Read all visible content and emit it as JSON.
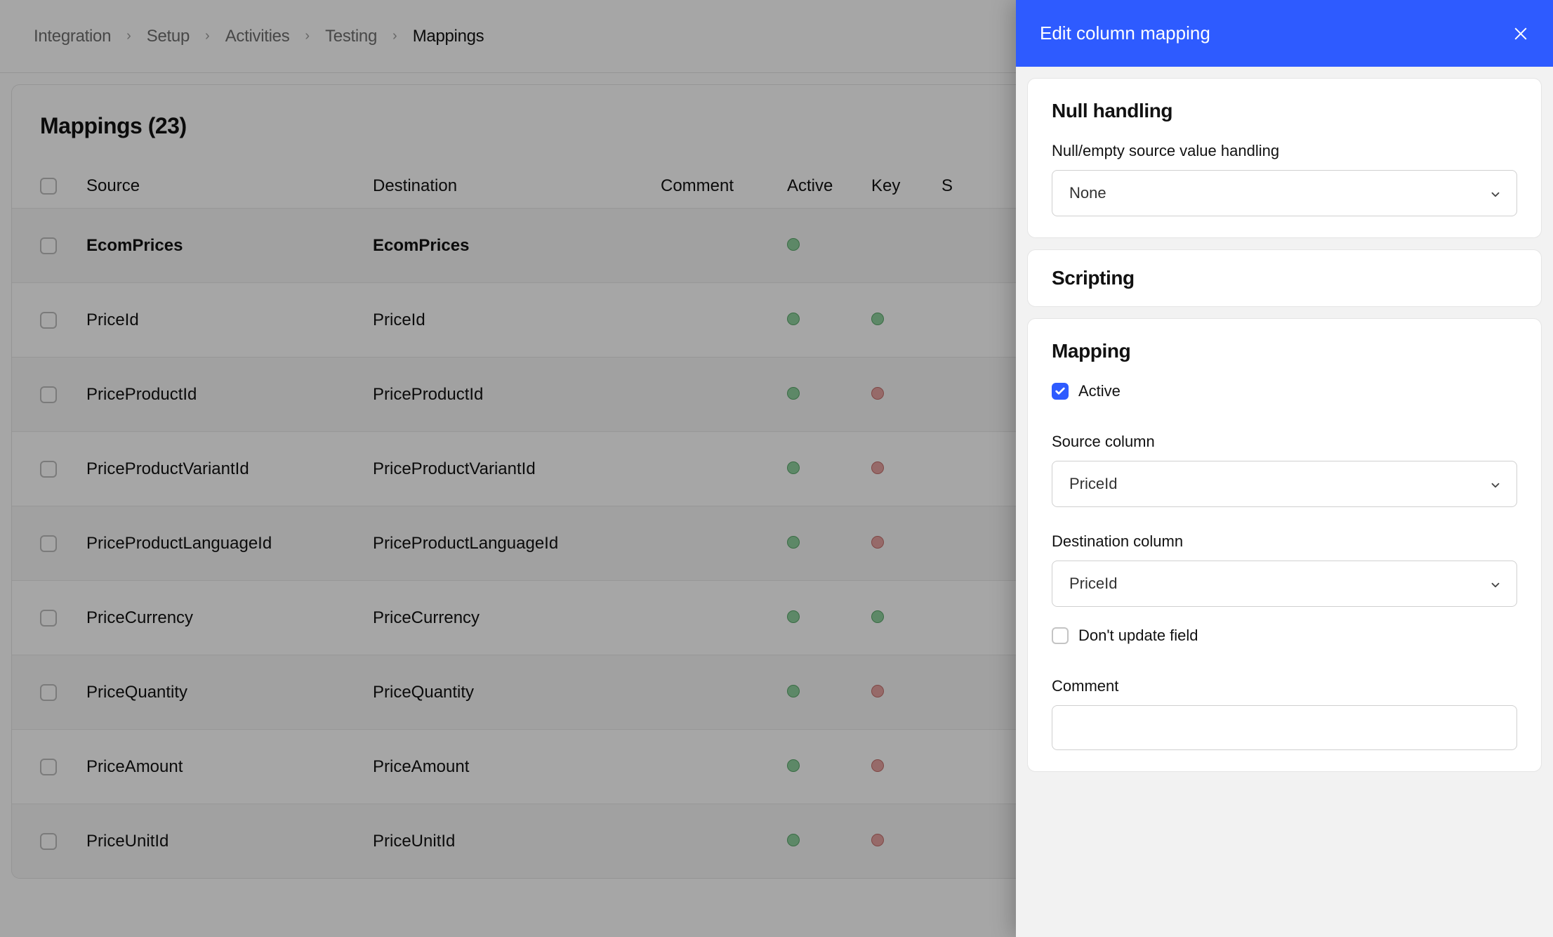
{
  "breadcrumb": {
    "items": [
      "Integration",
      "Setup",
      "Activities",
      "Testing",
      "Mappings"
    ],
    "currentIndex": 4
  },
  "card": {
    "title": "Mappings (23)"
  },
  "table": {
    "headers": {
      "source": "Source",
      "destination": "Destination",
      "comment": "Comment",
      "active": "Active",
      "key": "Key",
      "s": "S"
    },
    "rows": [
      {
        "source": "EcomPrices",
        "destination": "EcomPrices",
        "active": true,
        "key": null,
        "bold": true
      },
      {
        "source": "PriceId",
        "destination": "PriceId",
        "active": true,
        "key": "green",
        "bold": false
      },
      {
        "source": "PriceProductId",
        "destination": "PriceProductId",
        "active": true,
        "key": "red",
        "bold": false
      },
      {
        "source": "PriceProductVariantId",
        "destination": "PriceProductVariantId",
        "active": true,
        "key": "red",
        "bold": false
      },
      {
        "source": "PriceProductLanguageId",
        "destination": "PriceProductLanguageId",
        "active": true,
        "key": "red",
        "bold": false
      },
      {
        "source": "PriceCurrency",
        "destination": "PriceCurrency",
        "active": true,
        "key": "green",
        "bold": false
      },
      {
        "source": "PriceQuantity",
        "destination": "PriceQuantity",
        "active": true,
        "key": "red",
        "bold": false
      },
      {
        "source": "PriceAmount",
        "destination": "PriceAmount",
        "active": true,
        "key": "red",
        "bold": false
      },
      {
        "source": "PriceUnitId",
        "destination": "PriceUnitId",
        "active": true,
        "key": "red",
        "bold": false
      }
    ]
  },
  "panel": {
    "title": "Edit column mapping",
    "sections": {
      "nullHandling": {
        "title": "Null handling",
        "label": "Null/empty source value handling",
        "value": "None"
      },
      "scripting": {
        "title": "Scripting"
      },
      "mapping": {
        "title": "Mapping",
        "activeLabel": "Active",
        "activeChecked": true,
        "sourceLabel": "Source column",
        "sourceValue": "PriceId",
        "destLabel": "Destination column",
        "destValue": "PriceId",
        "dontUpdateLabel": "Don't update field",
        "dontUpdateChecked": false,
        "commentLabel": "Comment",
        "commentValue": ""
      }
    }
  }
}
